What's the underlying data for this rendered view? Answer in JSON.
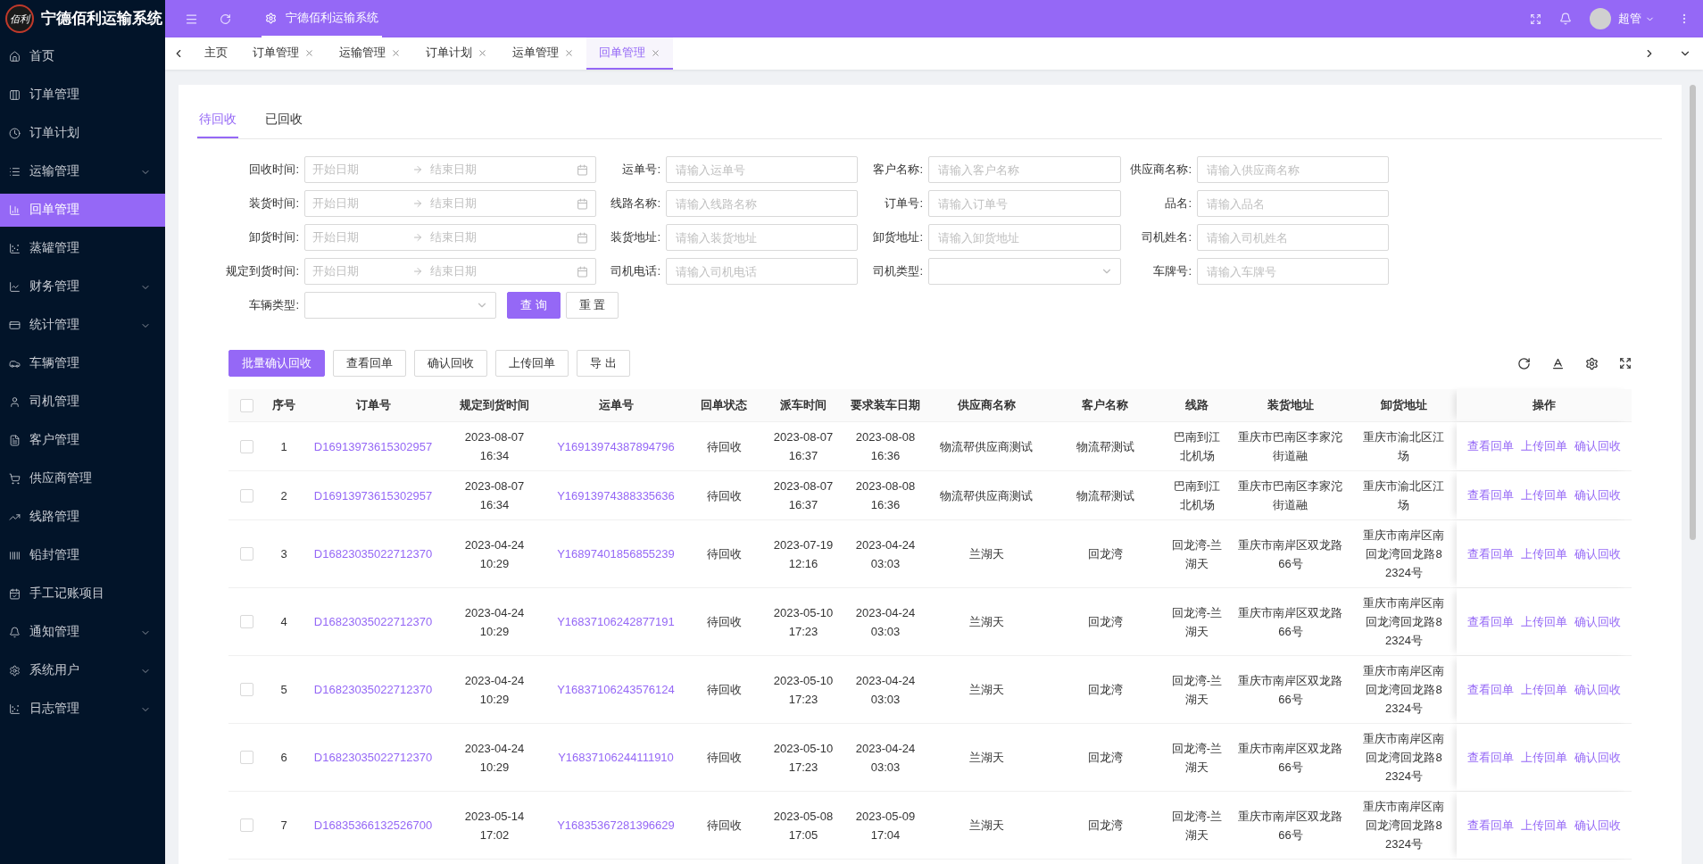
{
  "app": {
    "logo_text": "佰利",
    "title": "宁德佰利运输系统"
  },
  "header": {
    "breadcrumb": "宁德佰利运输系统",
    "user": "超管"
  },
  "sidebar": {
    "items": [
      {
        "label": "首页",
        "selected": false,
        "expandable": false
      },
      {
        "label": "订单管理",
        "selected": false,
        "expandable": false
      },
      {
        "label": "订单计划",
        "selected": false,
        "expandable": false
      },
      {
        "label": "运输管理",
        "selected": false,
        "expandable": true
      },
      {
        "label": "回单管理",
        "selected": true,
        "expandable": false
      },
      {
        "label": "蒸罐管理",
        "selected": false,
        "expandable": false
      },
      {
        "label": "财务管理",
        "selected": false,
        "expandable": true
      },
      {
        "label": "统计管理",
        "selected": false,
        "expandable": true
      },
      {
        "label": "车辆管理",
        "selected": false,
        "expandable": false
      },
      {
        "label": "司机管理",
        "selected": false,
        "expandable": false
      },
      {
        "label": "客户管理",
        "selected": false,
        "expandable": false
      },
      {
        "label": "供应商管理",
        "selected": false,
        "expandable": false
      },
      {
        "label": "线路管理",
        "selected": false,
        "expandable": false
      },
      {
        "label": "铅封管理",
        "selected": false,
        "expandable": false
      },
      {
        "label": "手工记账项目",
        "selected": false,
        "expandable": false
      },
      {
        "label": "通知管理",
        "selected": false,
        "expandable": true
      },
      {
        "label": "系统用户",
        "selected": false,
        "expandable": true
      },
      {
        "label": "日志管理",
        "selected": false,
        "expandable": true
      }
    ]
  },
  "tabs": [
    {
      "label": "主页",
      "selected": false,
      "closable": false
    },
    {
      "label": "订单管理",
      "selected": false,
      "closable": true
    },
    {
      "label": "运输管理",
      "selected": false,
      "closable": true
    },
    {
      "label": "订单计划",
      "selected": false,
      "closable": true
    },
    {
      "label": "运单管理",
      "selected": false,
      "closable": true
    },
    {
      "label": "回单管理",
      "selected": true,
      "closable": true
    }
  ],
  "subtabs": [
    {
      "label": "待回收",
      "selected": true
    },
    {
      "label": "已回收",
      "selected": false
    }
  ],
  "filters": [
    {
      "kind": "daterange",
      "label": "回收时间:",
      "start_placeholder": "开始日期",
      "end_placeholder": "结束日期"
    },
    {
      "kind": "text",
      "label": "运单号:",
      "placeholder": "请输入运单号"
    },
    {
      "kind": "text",
      "label": "客户名称:",
      "placeholder": "请输入客户名称"
    },
    {
      "kind": "text",
      "label": "供应商名称:",
      "placeholder": "请输入供应商名称"
    },
    {
      "kind": "daterange",
      "label": "装货时间:",
      "start_placeholder": "开始日期",
      "end_placeholder": "结束日期"
    },
    {
      "kind": "text",
      "label": "线路名称:",
      "placeholder": "请输入线路名称"
    },
    {
      "kind": "text",
      "label": "订单号:",
      "placeholder": "请输入订单号"
    },
    {
      "kind": "text",
      "label": "品名:",
      "placeholder": "请输入品名"
    },
    {
      "kind": "daterange",
      "label": "卸货时间:",
      "start_placeholder": "开始日期",
      "end_placeholder": "结束日期"
    },
    {
      "kind": "text",
      "label": "装货地址:",
      "placeholder": "请输入装货地址"
    },
    {
      "kind": "text",
      "label": "卸货地址:",
      "placeholder": "请输入卸货地址"
    },
    {
      "kind": "text",
      "label": "司机姓名:",
      "placeholder": "请输入司机姓名"
    },
    {
      "kind": "daterange",
      "label": "规定到货时间:",
      "start_placeholder": "开始日期",
      "end_placeholder": "结束日期"
    },
    {
      "kind": "text",
      "label": "司机电话:",
      "placeholder": "请输入司机电话"
    },
    {
      "kind": "select",
      "label": "司机类型:"
    },
    {
      "kind": "text",
      "label": "车牌号:",
      "placeholder": "请输入车牌号"
    },
    {
      "kind": "select",
      "label": "车辆类型:"
    }
  ],
  "form_buttons": [
    {
      "label": "查 询",
      "primary": true
    },
    {
      "label": "重 置",
      "primary": false
    }
  ],
  "actions": [
    {
      "label": "批量确认回收",
      "primary": true
    },
    {
      "label": "查看回单",
      "primary": false
    },
    {
      "label": "确认回收",
      "primary": false
    },
    {
      "label": "上传回单",
      "primary": false
    },
    {
      "label": "导 出",
      "primary": false
    }
  ],
  "table": {
    "all_selected": false,
    "columns": [
      "序号",
      "订单号",
      "规定到货时间",
      "运单号",
      "回单状态",
      "派车时间",
      "要求装车日期",
      "供应商名称",
      "客户名称",
      "线路",
      "装货地址",
      "卸货地址",
      "操作"
    ],
    "rows": [
      {
        "selected": false,
        "index": "1",
        "order_no": "D16913973615302957",
        "arrival_time": "2023-08-07\n16:34",
        "waybill_no": "Y16913974387894796",
        "status": "待回收",
        "dispatch_time": "2023-08-07\n16:37",
        "load_date": "2023-08-08\n16:36",
        "supplier": "物流帮供应商测试",
        "customer": "物流帮测试",
        "route": "巴南到江北机场",
        "load_address": "重庆市巴南区李家沱街道融",
        "unload_address": "重庆市渝北区江场",
        "actions": [
          "查看回单",
          "上传回单",
          "确认回收"
        ]
      },
      {
        "selected": false,
        "index": "2",
        "order_no": "D16913973615302957",
        "arrival_time": "2023-08-07\n16:34",
        "waybill_no": "Y16913974388335636",
        "status": "待回收",
        "dispatch_time": "2023-08-07\n16:37",
        "load_date": "2023-08-08\n16:36",
        "supplier": "物流帮供应商测试",
        "customer": "物流帮测试",
        "route": "巴南到江北机场",
        "load_address": "重庆市巴南区李家沱街道融",
        "unload_address": "重庆市渝北区江场",
        "actions": [
          "查看回单",
          "上传回单",
          "确认回收"
        ]
      },
      {
        "selected": false,
        "index": "3",
        "order_no": "D16823035022712370",
        "arrival_time": "2023-04-24\n10:29",
        "waybill_no": "Y16897401856855239",
        "status": "待回收",
        "dispatch_time": "2023-07-19\n12:16",
        "load_date": "2023-04-24\n03:03",
        "supplier": "兰湖天",
        "customer": "回龙湾",
        "route": "回龙湾-兰湖天",
        "load_address": "重庆市南岸区双龙路66号",
        "unload_address": "重庆市南岸区南回龙湾回龙路82324号",
        "actions": [
          "查看回单",
          "上传回单",
          "确认回收"
        ]
      },
      {
        "selected": false,
        "index": "4",
        "order_no": "D16823035022712370",
        "arrival_time": "2023-04-24\n10:29",
        "waybill_no": "Y16837106242877191",
        "status": "待回收",
        "dispatch_time": "2023-05-10\n17:23",
        "load_date": "2023-04-24\n03:03",
        "supplier": "兰湖天",
        "customer": "回龙湾",
        "route": "回龙湾-兰湖天",
        "load_address": "重庆市南岸区双龙路66号",
        "unload_address": "重庆市南岸区南回龙湾回龙路82324号",
        "actions": [
          "查看回单",
          "上传回单",
          "确认回收"
        ]
      },
      {
        "selected": false,
        "index": "5",
        "order_no": "D16823035022712370",
        "arrival_time": "2023-04-24\n10:29",
        "waybill_no": "Y16837106243576124",
        "status": "待回收",
        "dispatch_time": "2023-05-10\n17:23",
        "load_date": "2023-04-24\n03:03",
        "supplier": "兰湖天",
        "customer": "回龙湾",
        "route": "回龙湾-兰湖天",
        "load_address": "重庆市南岸区双龙路66号",
        "unload_address": "重庆市南岸区南回龙湾回龙路82324号",
        "actions": [
          "查看回单",
          "上传回单",
          "确认回收"
        ]
      },
      {
        "selected": false,
        "index": "6",
        "order_no": "D16823035022712370",
        "arrival_time": "2023-04-24\n10:29",
        "waybill_no": "Y16837106244111910",
        "status": "待回收",
        "dispatch_time": "2023-05-10\n17:23",
        "load_date": "2023-04-24\n03:03",
        "supplier": "兰湖天",
        "customer": "回龙湾",
        "route": "回龙湾-兰湖天",
        "load_address": "重庆市南岸区双龙路66号",
        "unload_address": "重庆市南岸区南回龙湾回龙路82324号",
        "actions": [
          "查看回单",
          "上传回单",
          "确认回收"
        ]
      },
      {
        "selected": false,
        "index": "7",
        "order_no": "D16835366132526700",
        "arrival_time": "2023-05-14\n17:02",
        "waybill_no": "Y16835367281396629",
        "status": "待回收",
        "dispatch_time": "2023-05-08\n17:05",
        "load_date": "2023-05-09\n17:04",
        "supplier": "兰湖天",
        "customer": "回龙湾",
        "route": "回龙湾-兰湖天",
        "load_address": "重庆市南岸区双龙路66号",
        "unload_address": "重庆市南岸区南回龙湾回龙路82324号",
        "actions": [
          "查看回单",
          "上传回单",
          "确认回收"
        ]
      }
    ]
  }
}
